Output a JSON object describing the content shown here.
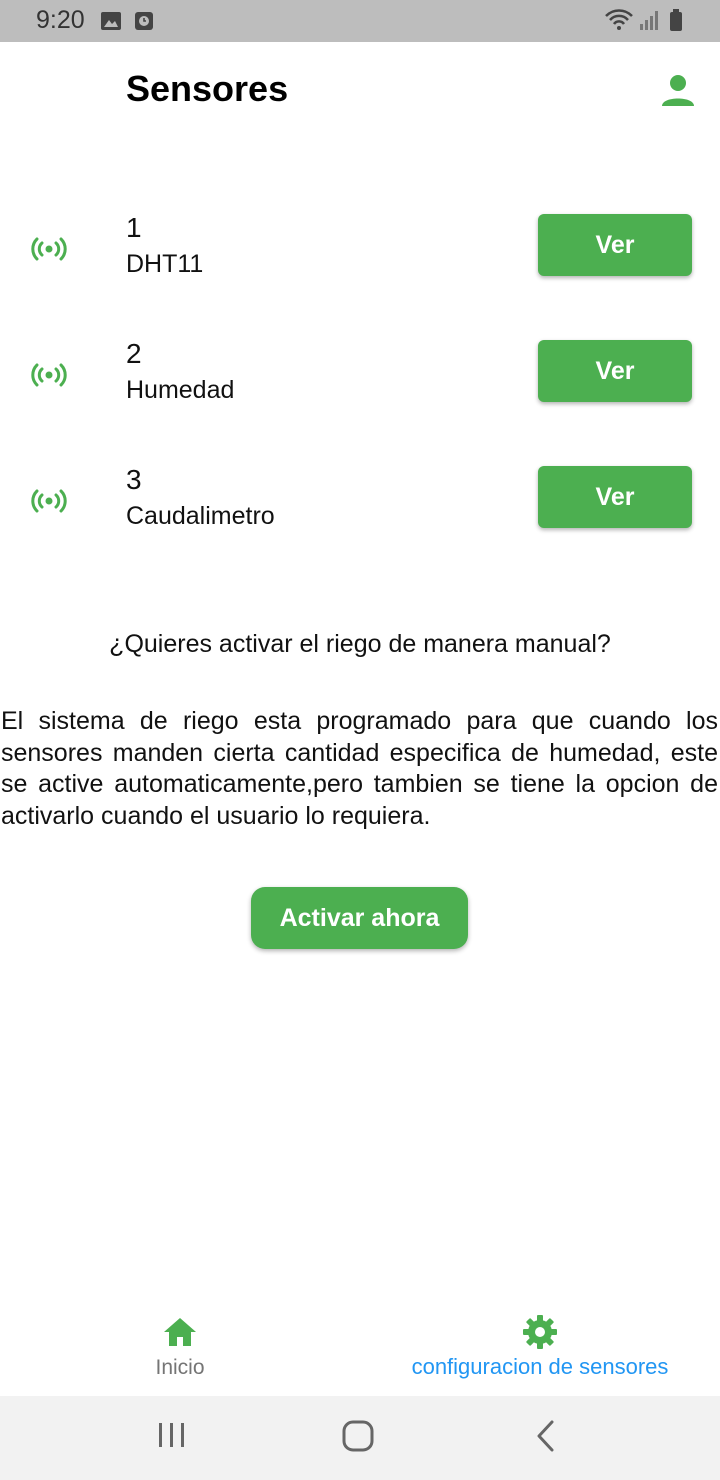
{
  "status_bar": {
    "time": "9:20",
    "icons": [
      "image-icon",
      "clock-icon",
      "wifi-icon",
      "signal-icon",
      "battery-icon"
    ]
  },
  "app_bar": {
    "title": "Sensores",
    "profile_icon": "person-icon"
  },
  "sensors": [
    {
      "id": "1",
      "name": "DHT11",
      "button_label": "Ver",
      "icon": "sensor-signal-icon"
    },
    {
      "id": "2",
      "name": "Humedad",
      "button_label": "Ver",
      "icon": "sensor-signal-icon"
    },
    {
      "id": "3",
      "name": "Caudalimetro",
      "button_label": "Ver",
      "icon": "sensor-signal-icon"
    }
  ],
  "manual": {
    "question": "¿Quieres activar el riego de manera manual?",
    "description": "El sistema de riego esta programado para que cuando los sensores manden cierta cantidad especifica de humedad, este se active automaticamente,pero tambien se tiene la opcion de activarlo cuando el usuario lo requiera.",
    "button_label": "Activar ahora"
  },
  "bottom_nav": {
    "items": [
      {
        "label": "Inicio",
        "icon": "home-icon",
        "active": false
      },
      {
        "label": "configuracion de sensores",
        "icon": "gear-icon",
        "active": true
      }
    ]
  },
  "colors": {
    "accent": "#4caf50",
    "active_nav_text": "#2196f3",
    "inactive_nav_text": "#757575"
  }
}
